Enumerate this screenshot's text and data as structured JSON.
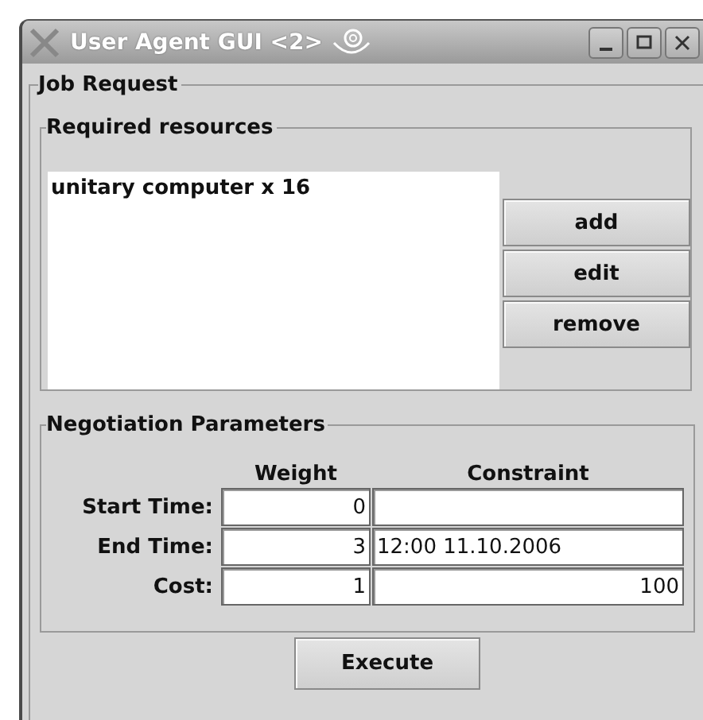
{
  "window": {
    "title": "User Agent GUI <2>"
  },
  "job_request": {
    "title": "Job Request",
    "required_resources": {
      "title": "Required resources",
      "items": [
        "unitary computer x 16"
      ],
      "buttons": [
        "add",
        "edit",
        "remove"
      ]
    },
    "negotiation_parameters": {
      "title": "Negotiation Parameters",
      "columns": [
        "Weight",
        "Constraint"
      ],
      "rows": [
        {
          "label": "Start Time:",
          "weight": "0"
        },
        {
          "label": "End Time:",
          "weight": "3",
          "constraint": {
            "kind": "text",
            "value": "12:00 11.10.2006"
          }
        },
        {
          "label": "Cost:",
          "weight": "1",
          "constraint": {
            "kind": "number",
            "value": "100"
          }
        }
      ]
    },
    "execute_button": "Execute"
  }
}
